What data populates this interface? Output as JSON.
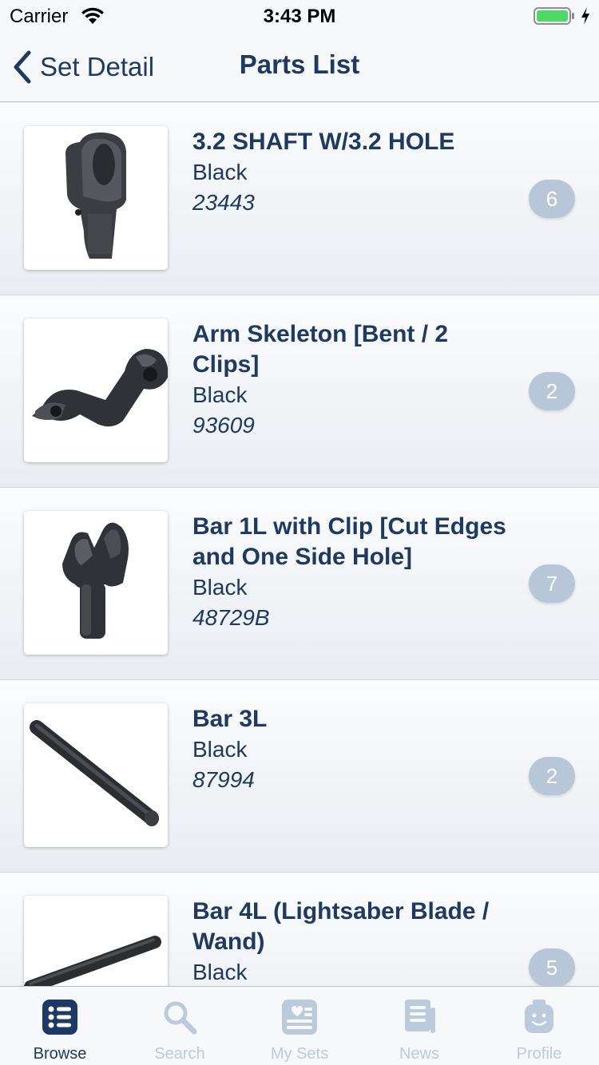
{
  "status_bar": {
    "carrier": "Carrier",
    "time": "3:43 PM",
    "battery_level": 1.0,
    "battery_color": "#4cd964"
  },
  "nav": {
    "back_label": "Set Detail",
    "title": "Parts List"
  },
  "parts": [
    {
      "name": "3.2 SHAFT W/3.2 HOLE",
      "color": "Black",
      "number": "23443",
      "quantity": "6",
      "icon": "shaft-with-hole-part-icon"
    },
    {
      "name": "Arm Skeleton [Bent / 2 Clips]",
      "color": "Black",
      "number": "93609",
      "quantity": "2",
      "icon": "arm-skeleton-part-icon"
    },
    {
      "name": "Bar 1L with Clip [Cut Edges and One Side Hole]",
      "color": "Black",
      "number": "48729B",
      "quantity": "7",
      "icon": "bar-with-clip-part-icon"
    },
    {
      "name": "Bar 3L",
      "color": "Black",
      "number": "87994",
      "quantity": "2",
      "icon": "bar-3l-part-icon"
    },
    {
      "name": "Bar 4L (Lightsaber Blade / Wand)",
      "color": "Black",
      "number": "",
      "quantity": "5",
      "icon": "bar-4l-part-icon"
    }
  ],
  "tabs": [
    {
      "label": "Browse",
      "icon": "browse-list-icon",
      "active": true
    },
    {
      "label": "Search",
      "icon": "search-icon",
      "active": false
    },
    {
      "label": "My Sets",
      "icon": "my-sets-icon",
      "active": false
    },
    {
      "label": "News",
      "icon": "news-icon",
      "active": false
    },
    {
      "label": "Profile",
      "icon": "profile-minifig-icon",
      "active": false
    }
  ],
  "colors": {
    "primary": "#1c3a63",
    "badge": "#b7c7d8",
    "tab_inactive": "#bccbdb"
  }
}
